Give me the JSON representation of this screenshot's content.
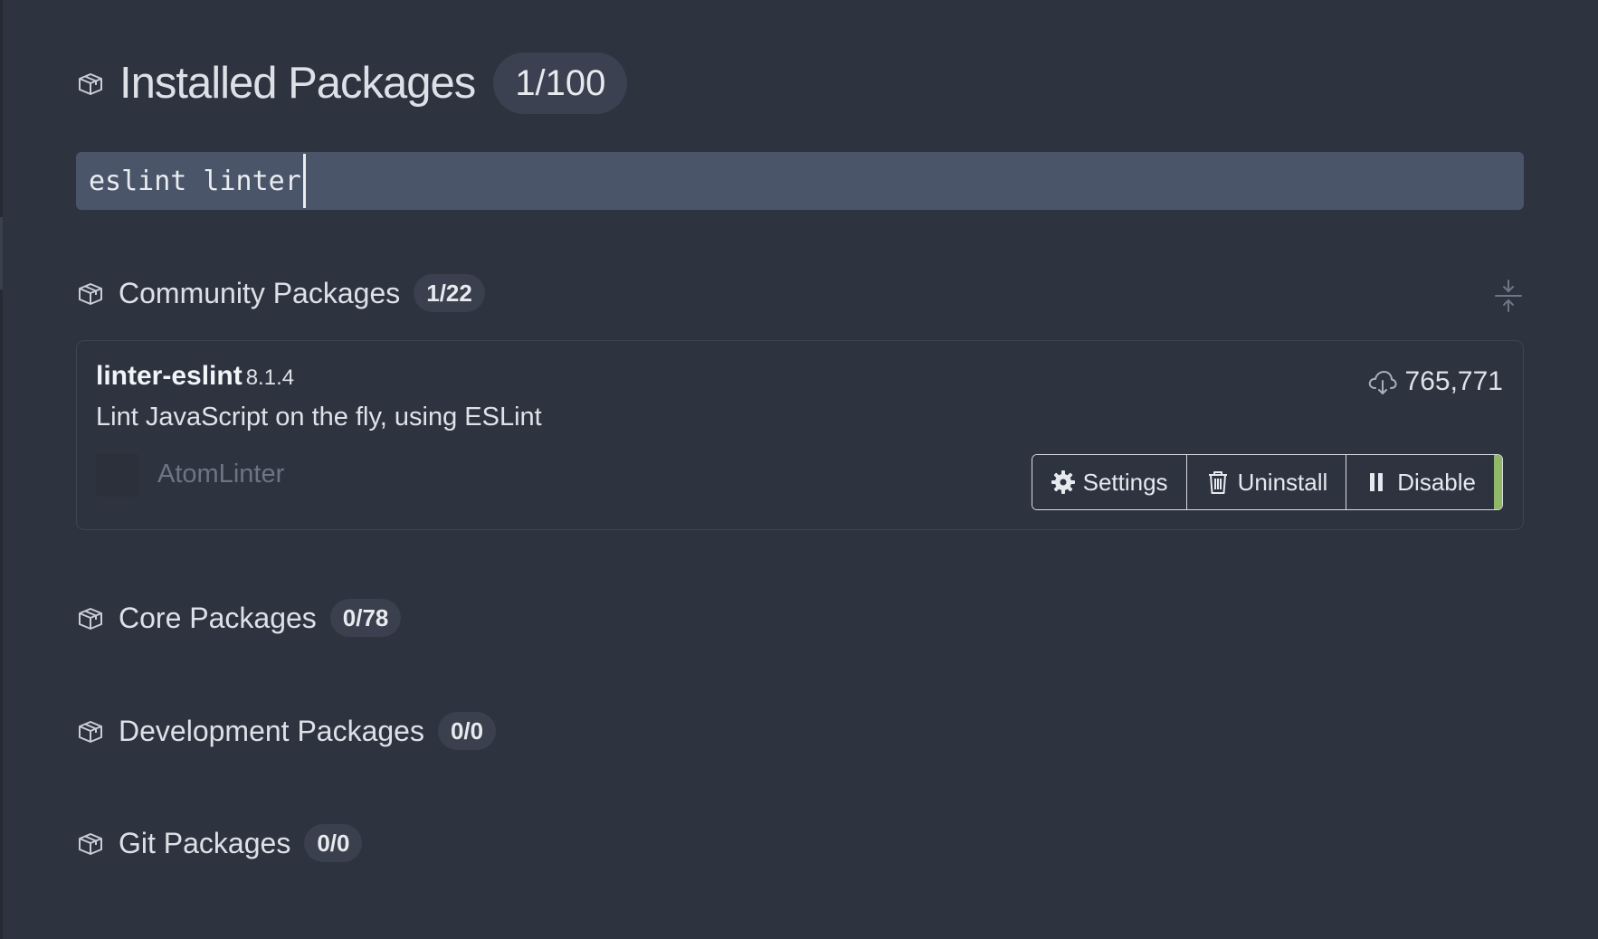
{
  "header": {
    "title": "Installed Packages",
    "count": "1/100"
  },
  "search": {
    "value": "eslint linter"
  },
  "sections": {
    "community": {
      "title": "Community Packages",
      "count": "1/22"
    },
    "core": {
      "title": "Core Packages",
      "count": "0/78"
    },
    "development": {
      "title": "Development Packages",
      "count": "0/0"
    },
    "git": {
      "title": "Git Packages",
      "count": "0/0"
    }
  },
  "package": {
    "name": "linter-eslint",
    "version": "8.1.4",
    "description": "Lint JavaScript on the fly, using ESLint",
    "downloads": "765,771",
    "author": "AtomLinter",
    "buttons": {
      "settings": "Settings",
      "uninstall": "Uninstall",
      "disable": "Disable"
    },
    "enabled_color": "#8fb869"
  },
  "icons": {
    "section": "package-icon",
    "collapse": "fold-icon",
    "downloads": "cloud-download-icon",
    "settings": "gear-icon",
    "uninstall": "trash-icon",
    "disable": "pause-icon"
  }
}
